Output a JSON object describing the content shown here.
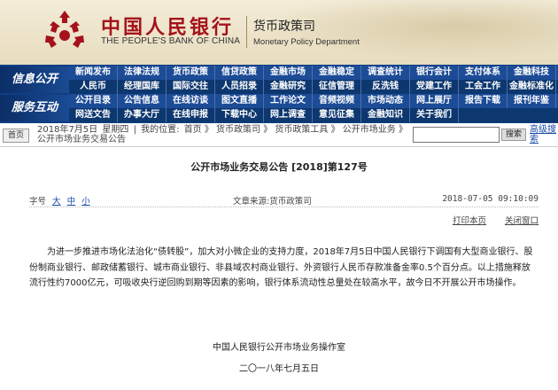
{
  "header": {
    "bank_name_cn": "中国人民银行",
    "bank_name_en": "THE PEOPLE'S BANK OF CHINA",
    "dept_cn": "货币政策司",
    "dept_en": "Monetary Policy Department",
    "logo_icon": "pboc-logo-icon"
  },
  "nav": {
    "section1": "信息公开",
    "section2": "服务互动",
    "row1": [
      "新闻发布",
      "法律法规",
      "货币政策",
      "信贷政策",
      "金融市场",
      "金融稳定",
      "调查统计",
      "银行会计",
      "支付体系",
      "金融科技"
    ],
    "row2": [
      "人民币",
      "经理国库",
      "国际交往",
      "人员招录",
      "金融研究",
      "征信管理",
      "反洗钱",
      "党建工作",
      "工会工作",
      "金融标准化"
    ],
    "row3": [
      "公开目录",
      "公告信息",
      "在线访谈",
      "图文直播",
      "工作论文",
      "音频视频",
      "市场动态",
      "网上展厅",
      "报告下载",
      "报刊年鉴"
    ],
    "row4": [
      "网送文告",
      "办事大厅",
      "在线申报",
      "下载中心",
      "网上调查",
      "意见征集",
      "金融知识",
      "关于我们"
    ]
  },
  "breadcrumb": {
    "home_label": "首页",
    "date": "2018年7月5日",
    "weekday": "星期四",
    "location_label": "我的位置:",
    "path": "首页 》 货币政策司 》 货币政策工具 》 公开市场业务 》 公开市场业务交易公告",
    "search_button": "搜索",
    "advanced_search": "高级搜索",
    "search_value": ""
  },
  "article": {
    "title": "公开市场业务交易公告 [2018]第127号",
    "font_size_label": "字号",
    "font_sizes": [
      "大",
      "中",
      "小"
    ],
    "source": "文章来源:货币政策司",
    "timestamp": "2018-07-05 09:10:09",
    "print_label": "打印本页",
    "close_label": "关闭窗口",
    "body": "为进一步推进市场化法治化“债转股”，加大对小微企业的支持力度，2018年7月5日中国人民银行下调国有大型商业银行、股份制商业银行、邮政储蓄银行、城市商业银行、非县域农村商业银行、外资银行人民币存款准备金率0.5个百分点。以上措施释放流行性约7000亿元，可吸收央行逆回购到期等因素的影响，银行体系流动性总量处在较高水平，故今日不开展公开市场操作。",
    "signature_org": "中国人民银行公开市场业务操作室",
    "signature_date": "二〇一八年七月五日"
  }
}
